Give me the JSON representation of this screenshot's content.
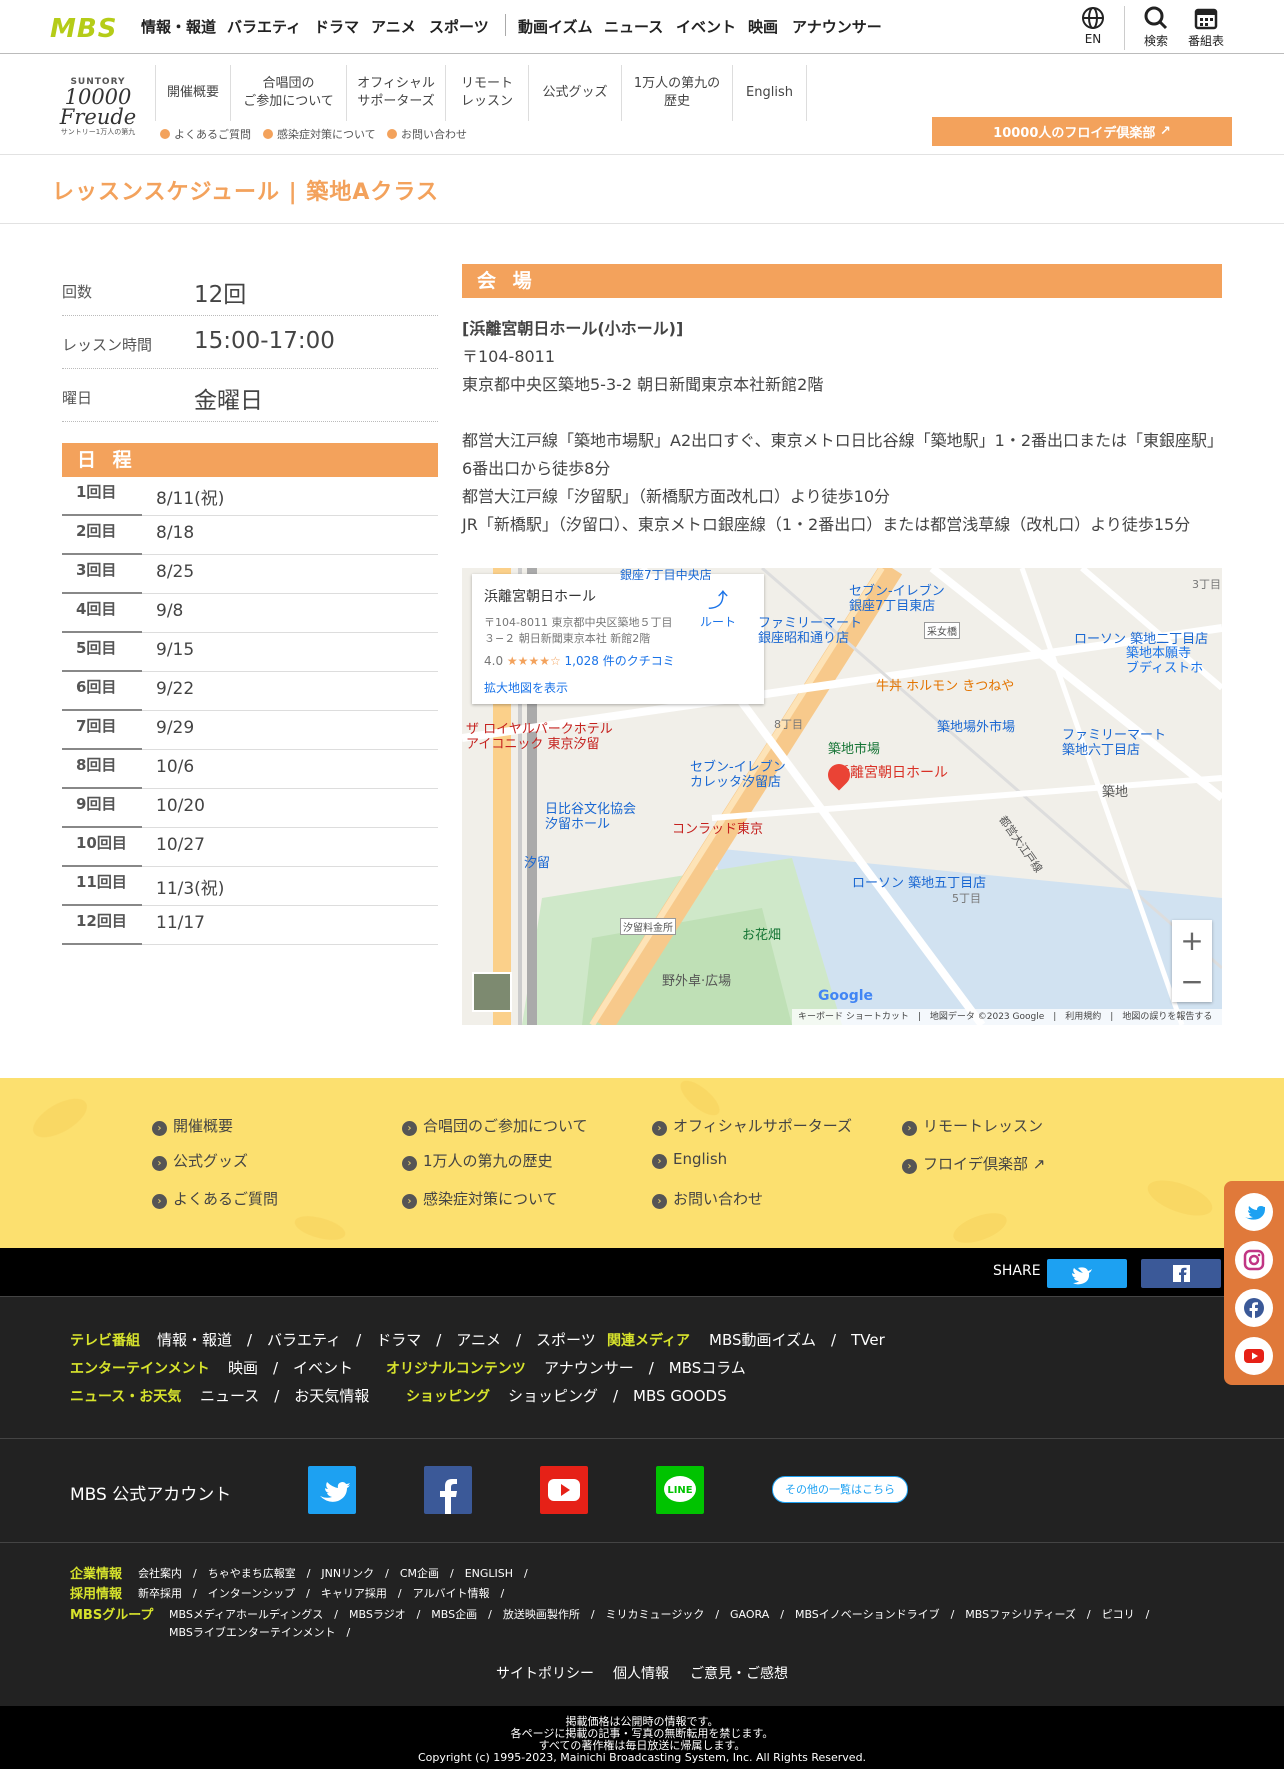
{
  "topnav": {
    "logo": "MBS",
    "items": [
      "情報・報道",
      "バラエティ",
      "ドラマ",
      "アニメ",
      "スポーツ",
      "動画イズム",
      "ニュース",
      "イベント",
      "映画",
      "アナウンサー"
    ],
    "lang_label": "EN",
    "search_label": "検索",
    "schedule_label": "番組表"
  },
  "subhead": {
    "logo_top": "SUNTORY",
    "logo_main": "10000 Freude",
    "logo_sub": "サントリー1万人の第九",
    "nav": [
      {
        "label": "開催概要"
      },
      {
        "label": "合唱団の\nご参加について"
      },
      {
        "label": "オフィシャル\nサポーターズ"
      },
      {
        "label": "リモート\nレッスン"
      },
      {
        "label": "公式グッズ"
      },
      {
        "label": "1万人の第九の\n歴史"
      },
      {
        "label": "English"
      }
    ],
    "sublinks": [
      "よくあるご質問",
      "感染症対策について",
      "お問い合わせ"
    ],
    "club_button": "10000人のフロイデ倶楽部"
  },
  "page_title": "レッスンスケジュール | 築地Aクラス",
  "info": [
    {
      "label": "回数",
      "value": "12回"
    },
    {
      "label": "レッスン時間",
      "value": "15:00-17:00"
    },
    {
      "label": "曜日",
      "value": "金曜日"
    }
  ],
  "schedule": {
    "heading": "日 程",
    "rows": [
      {
        "no": "1回目",
        "date": "8/11(祝)"
      },
      {
        "no": "2回目",
        "date": "8/18"
      },
      {
        "no": "3回目",
        "date": "8/25"
      },
      {
        "no": "4回目",
        "date": "9/8"
      },
      {
        "no": "5回目",
        "date": "9/15"
      },
      {
        "no": "6回目",
        "date": "9/22"
      },
      {
        "no": "7回目",
        "date": "9/29"
      },
      {
        "no": "8回目",
        "date": "10/6"
      },
      {
        "no": "9回目",
        "date": "10/20"
      },
      {
        "no": "10回目",
        "date": "10/27"
      },
      {
        "no": "11回目",
        "date": "11/3(祝)"
      },
      {
        "no": "12回目",
        "date": "11/17"
      }
    ]
  },
  "venue": {
    "heading": "会 場",
    "name": "[浜離宮朝日ホール(小ホール)]",
    "postal": "〒104-8011",
    "address": "東京都中央区築地5-3-2 朝日新聞東京本社新館2階",
    "access": [
      "都営大江戸線「築地市場駅」A2出口すぐ、東京メトロ日比谷線「築地駅」1・2番出口または「東銀座駅」",
      "6番出口から徒歩8分",
      "都営大江戸線「汐留駅」（新橋駅方面改札口）より徒歩10分",
      "JR「新橋駅」（汐留口）、東京メトロ銀座線（1・2番出口）または都営浅草線（改札口）より徒歩15分"
    ]
  },
  "map": {
    "card_title": "浜離宮朝日ホール",
    "card_addr1": "〒104-8011 東京都中央区築地５丁目",
    "card_addr2": "３−２ 朝日新聞東京本社 新館2階",
    "card_rating": "4.0",
    "card_stars": "★★★★☆",
    "card_reviews": "1,028 件のクチコミ",
    "card_route": "ルート",
    "card_enlarge": "拡大地図を表示",
    "labels": {
      "pin": "浜離宮朝日ホール",
      "seven1": "セブン-イレブン\n銀座7丁目東店",
      "family1": "ファミリーマート\n銀座昭和通り店",
      "lawson1": "ローソン 築地二丁目店",
      "honganji": "築地本願寺\nブディストホ",
      "horumon": "牛丼 ホルモン きつねや",
      "jogai": "築地場外市場",
      "family2": "ファミリーマート\n築地六丁目店",
      "royal": "ザ ロイヤルパークホテル\nアイコニック 東京汐留",
      "seven2": "セブン-イレブン\nカレッタ汐留店",
      "ichiba": "築地市場",
      "conrad": "コンラッド東京",
      "hitachi": "日比谷文化協会\n汐留ホール",
      "shiodome": "汐留",
      "lawson2": "ローソン 築地五丁目店",
      "ohanabata": "お花畑",
      "yagai": "野外卓·広場",
      "tsukiji": "築地",
      "shiodome_toll": "汐留料金所",
      "uneme": "采女橋",
      "ch8": "8丁目",
      "ch5": "5丁目",
      "ch3": "3丁目",
      "road": "都営大江戸線",
      "ginza7": "銀座7丁目中央店"
    },
    "footer": "キーボード ショートカット　|　地図データ ©2023 Google　|　利用規約　|　地図の誤りを報告する",
    "google": "Google"
  },
  "footer_links": [
    [
      "開催概要",
      "合唱団のご参加について",
      "オフィシャルサポーターズ",
      "リモートレッスン"
    ],
    [
      "公式グッズ",
      "1万人の第九の歴史",
      "English",
      "フロイデ倶楽部"
    ],
    [
      "よくあるご質問",
      "感染症対策について",
      "お問い合わせ"
    ]
  ],
  "share_label": "SHARE",
  "sitefoot": {
    "row1": {
      "cat1": "テレビ番組",
      "items1": "情報・報道　/　バラエティ　/　ドラマ　/　アニメ　/　スポーツ",
      "cat2": "関連メディア",
      "items2": "MBS動画イズム　/　TVer"
    },
    "row2": {
      "cat1": "エンターテインメント",
      "items1": "映画　/　イベント",
      "cat2": "オリジナルコンテンツ",
      "items2": "アナウンサー　/　MBSコラム"
    },
    "row3": {
      "cat1": "ニュース・お天気",
      "items1": "ニュース　/　お天気情報",
      "cat2": "ショッピング",
      "items2": "ショッピング　/　MBS GOODS"
    },
    "official_label": "MBS 公式アカウント",
    "more_button": "その他の一覧はこちら",
    "corp_cat": "企業情報",
    "corp_items": "会社案内　/　ちゃやまち広報室　/　JNNリンク　/　CM企画　/　ENGLISH　/",
    "recruit_cat": "採用情報",
    "recruit_items": "新卒採用　/　インターンシップ　/　キャリア採用　/　アルバイト情報　/",
    "group_cat": "MBSグループ",
    "group_items1": "MBSメディアホールディングス　/　MBSラジオ　/　MBS企画　/　放送映画製作所　/　ミリカミュージック　/　GAORA　/　MBSイノベーションドライブ　/　MBSファシリティーズ　/　ピコリ　/",
    "group_items2": "MBSライブエンターテインメント　/",
    "bottom_links": [
      "サイトポリシー",
      "個人情報",
      "ご意見・ご感想"
    ],
    "notice1": "掲載価格は公開時の情報です。",
    "notice2": "各ページに掲載の記事・写真の無断転用を禁じます。",
    "notice3": "すべての著作権は毎日放送に帰属します。",
    "copyright": "Copyright (c) 1995-2023, Mainichi Broadcasting System, Inc. All Rights Reserved."
  },
  "colors": {
    "accent": "#f3a25c",
    "mbs_green": "#b5cc18",
    "footer_yellow": "#fce06f",
    "twitter": "#1da1f2",
    "facebook": "#3b5998",
    "youtube": "#e62117",
    "line": "#00c300"
  }
}
